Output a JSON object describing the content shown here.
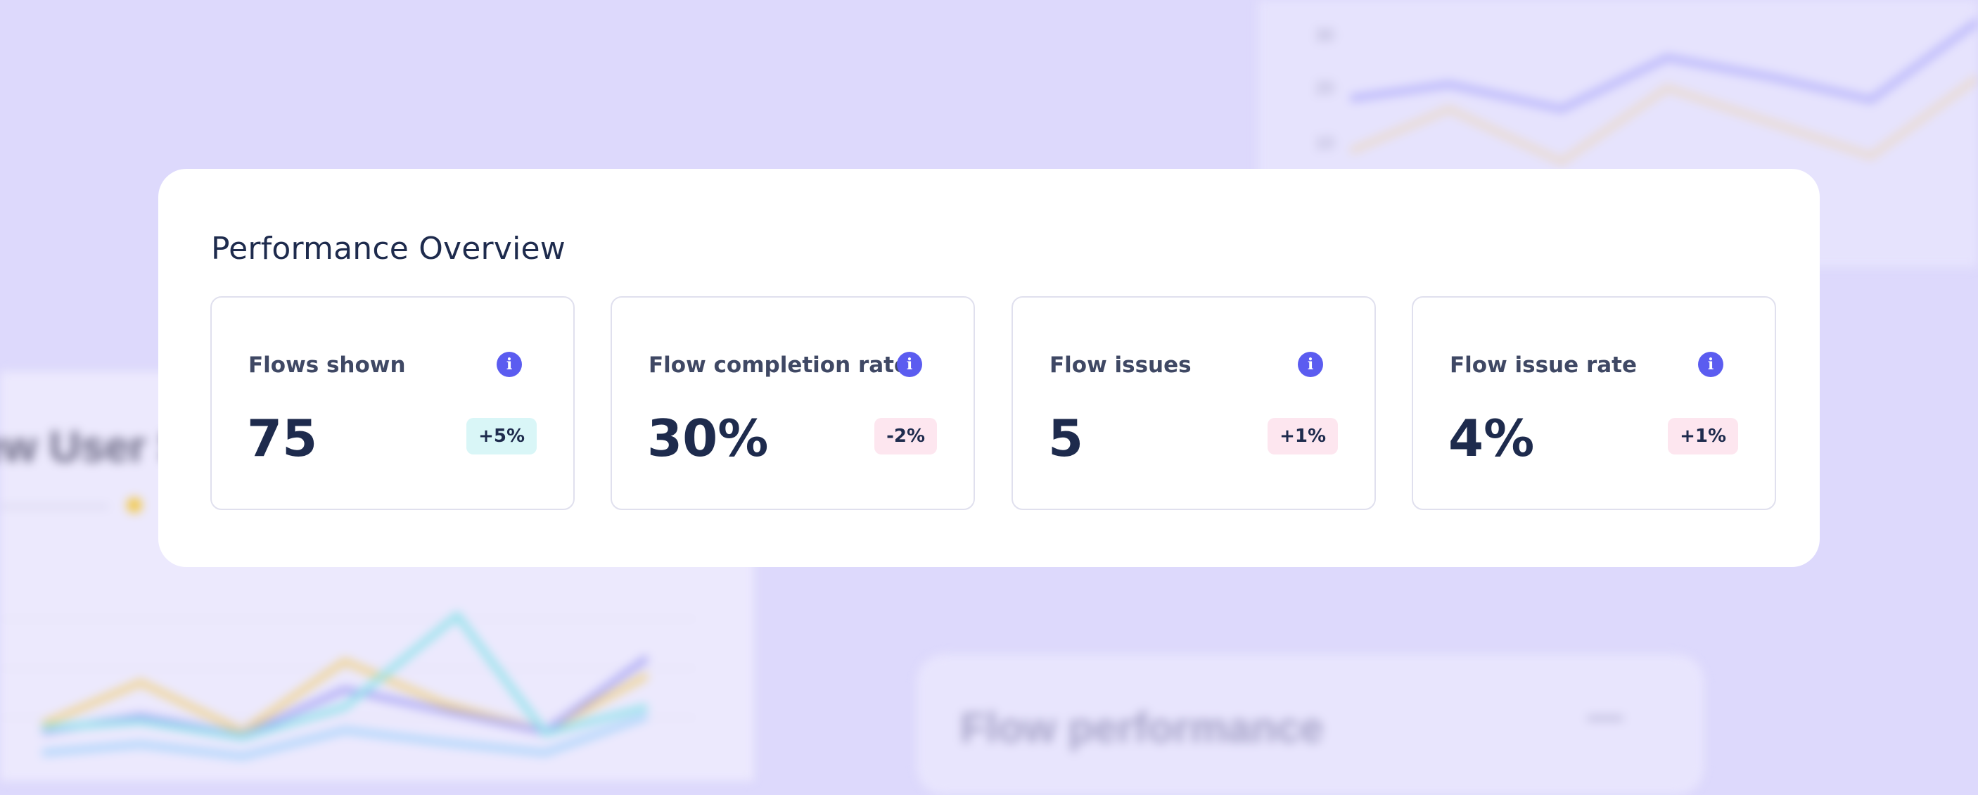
{
  "background": {
    "left_panel_title": "ew User S",
    "bottom_panel_title": "Flow performance",
    "y_ticks": [
      "30",
      "20",
      "10"
    ]
  },
  "overview": {
    "title": "Performance Overview",
    "metrics": [
      {
        "label": "Flows shown",
        "value": "75",
        "delta": "+5%",
        "delta_tone": "positive"
      },
      {
        "label": "Flow completion rate",
        "value": "30%",
        "delta": "-2%",
        "delta_tone": "negative"
      },
      {
        "label": "Flow issues",
        "value": "5",
        "delta": "+1%",
        "delta_tone": "negative"
      },
      {
        "label": "Flow issue rate",
        "value": "4%",
        "delta": "+1%",
        "delta_tone": "negative"
      }
    ],
    "info_icon": "info-icon"
  },
  "colors": {
    "page_background": "#ddd9fc",
    "accent": "#5b5cf0",
    "text_dark": "#1e2b4d",
    "badge_positive": "#d9f6f7",
    "badge_negative": "#fde6ef"
  }
}
